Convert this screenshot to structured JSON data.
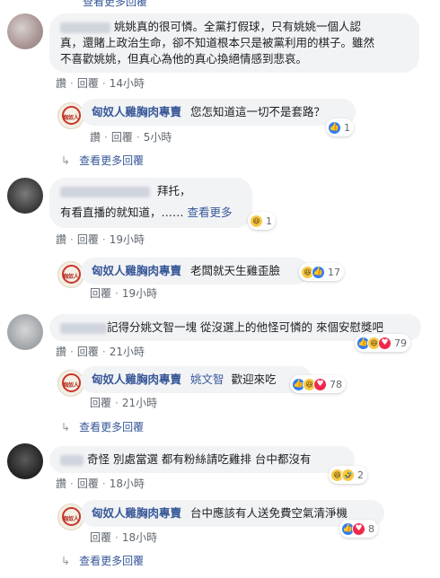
{
  "c1": {
    "text_line1": "姚姚真的很可憐。全黨打假球，只有姚姚一個人認",
    "text_line2": "真，還賭上政治生命，卻不知道根本只是被黨利用的棋子。雖然",
    "text_line3": "不喜歡姚姚，但真心為他的真心換絕情感到悲哀。",
    "like": "讚",
    "reply": "回覆",
    "time": "14小時",
    "reply1": {
      "name": "匈奴人雞胸肉專賣",
      "text": "您怎知道這一切不是套路？",
      "like": "讚",
      "reply": "回覆",
      "time": "5小時",
      "reaction_count": "1"
    },
    "more": "查看更多回覆"
  },
  "c2": {
    "text_line1": "拜托，",
    "text_line2": "有看直播的就知道，……",
    "see_more": "查看更多",
    "reaction_count": "1",
    "like": "讚",
    "reply": "回覆",
    "time": "19小時",
    "reply1": {
      "name": "匈奴人雞胸肉專賣",
      "text": "老闆就天生雞歪臉",
      "reply": "回覆",
      "time": "19小時",
      "reaction_count": "17"
    }
  },
  "c3": {
    "text": "記得分姚文智一塊 從沒選上的他怪可憐的 來個安慰獎吧",
    "reaction_count": "79",
    "like": "讚",
    "reply": "回覆",
    "time": "21小時",
    "reply1": {
      "name": "匈奴人雞胸肉專賣",
      "mention": "姚文智",
      "text": "歡迎來吃",
      "reply": "回覆",
      "time": "21小時",
      "reaction_count": "78"
    },
    "more": "查看更多回覆"
  },
  "c4": {
    "text": "奇怪 別處當選 都有粉絲請吃雞排 台中都沒有",
    "reaction_count": "2",
    "like": "讚",
    "reply": "回覆",
    "time": "18小時",
    "reply1": {
      "name": "匈奴人雞胸肉專賣",
      "text": "台中應該有人送免費空氣清淨機",
      "reply": "回覆",
      "time": "18小時",
      "reaction_count": "8"
    },
    "more": "查看更多回覆"
  },
  "top_more": "查看更多回覆",
  "logo_text": "匈奴人",
  "colors": {
    "link": "#385898",
    "bubble": "#f2f3f5",
    "like": "#2e7cf6",
    "love": "#f0284a",
    "haha": "#f7c948"
  }
}
